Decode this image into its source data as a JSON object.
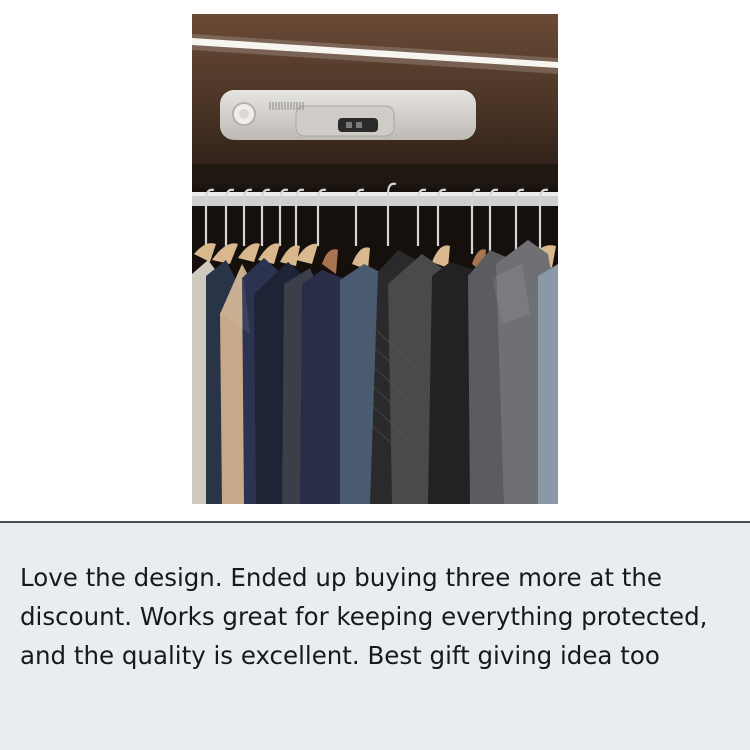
{
  "photo": {
    "subject": "closet-light-over-hanging-clothes",
    "colors": {
      "shelf": "#4a3426",
      "led_strip": "#f4f1ea",
      "device": "#d8d6d2",
      "rod": "#c9c9c9",
      "hanger_wood": "#d9b88e"
    }
  },
  "review": {
    "text": "Love the design. Ended up buying three more at the discount. Works great for keeping everything protected, and the quality is excellent. Best gift giving idea too"
  },
  "colors": {
    "caption_background": "#e9edf1",
    "caption_border": "#4a4d52",
    "caption_text": "#17191c"
  }
}
